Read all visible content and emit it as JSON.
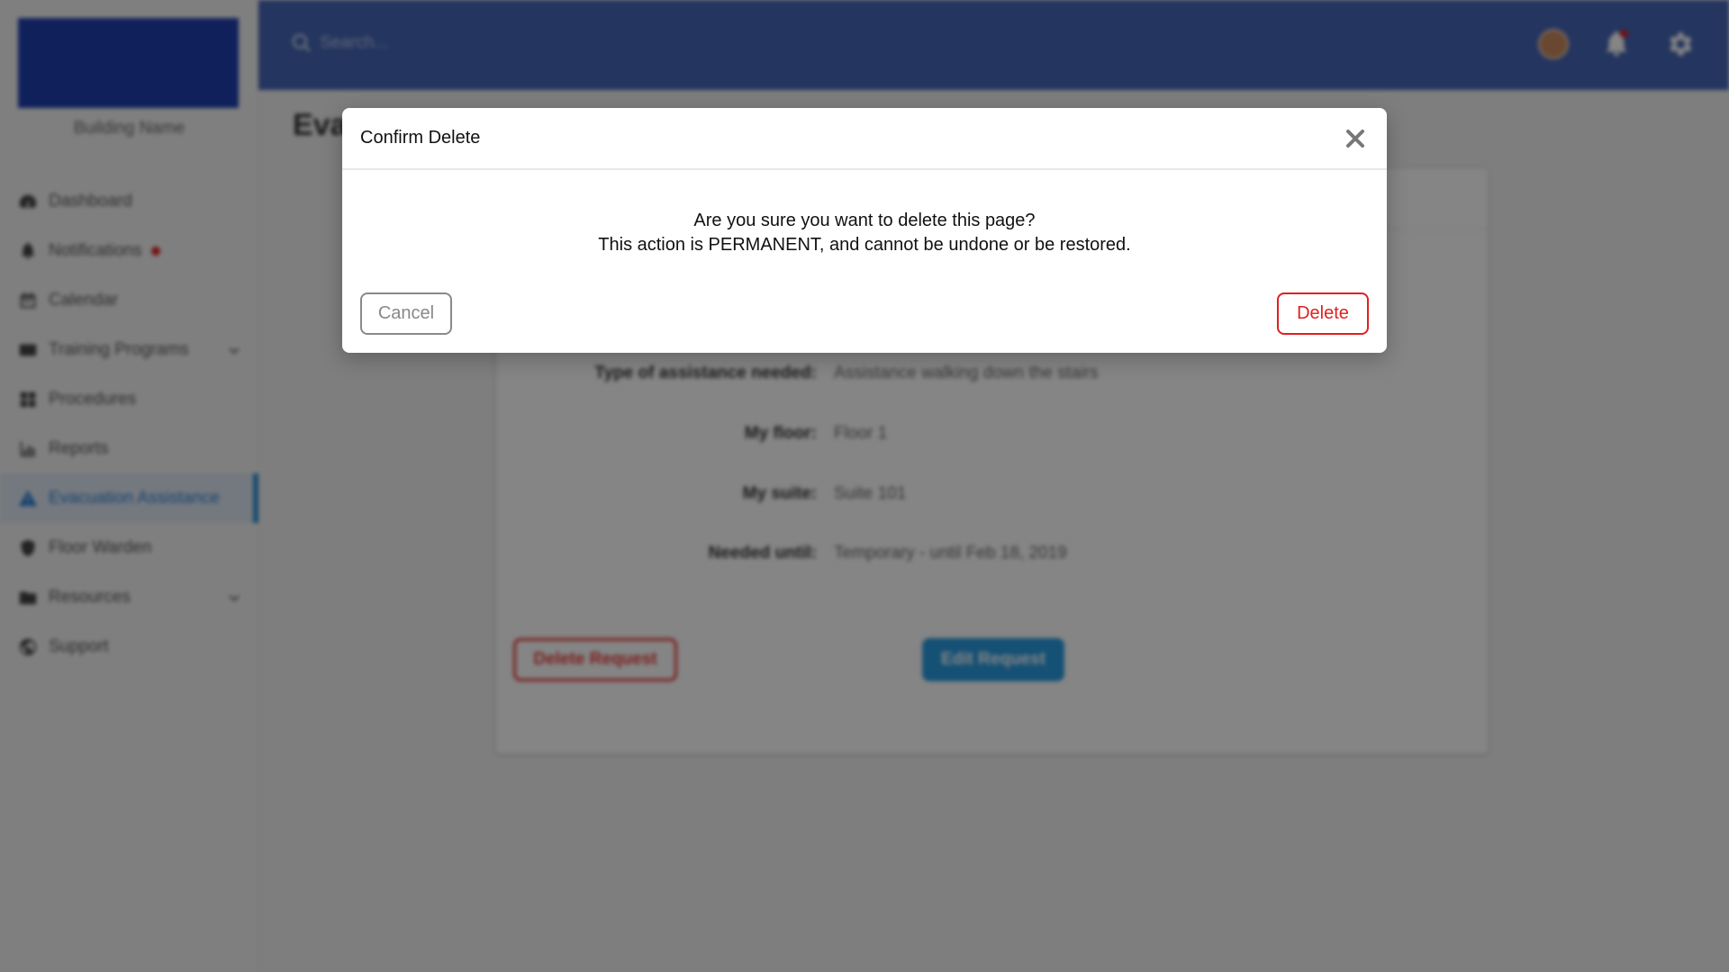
{
  "sidebar": {
    "building_name": "Building Name",
    "items": [
      {
        "label": "Dashboard",
        "icon": "dashboard-icon"
      },
      {
        "label": "Notifications",
        "icon": "bell-icon",
        "has_alert_dot": true
      },
      {
        "label": "Calendar",
        "icon": "calendar-icon"
      },
      {
        "label": "Training Programs",
        "icon": "training-icon",
        "has_chevron": true
      },
      {
        "label": "Procedures",
        "icon": "procedures-icon"
      },
      {
        "label": "Reports",
        "icon": "reports-icon"
      },
      {
        "label": "Evacuation Assistance",
        "icon": "warning-icon",
        "active": true
      },
      {
        "label": "Floor Warden",
        "icon": "shield-icon"
      },
      {
        "label": "Resources",
        "icon": "folder-icon",
        "has_chevron": true
      },
      {
        "label": "Support",
        "icon": "globe-icon"
      }
    ]
  },
  "topbar": {
    "search_placeholder": "Search...",
    "icons": [
      "avatar",
      "bell-icon",
      "gear-icon"
    ]
  },
  "page": {
    "title_visible": "Eva"
  },
  "card": {
    "details": [
      {
        "label": "Type of assistance needed:",
        "value": "Assistance walking down the stairs"
      },
      {
        "label": "My floor:",
        "value": "Floor 1"
      },
      {
        "label": "My suite:",
        "value": "Suite 101"
      },
      {
        "label": "Needed until:",
        "value": "Temporary - until Feb 18, 2019"
      }
    ],
    "delete_request_label": "Delete Request",
    "edit_request_label": "Edit Request"
  },
  "modal": {
    "title": "Confirm Delete",
    "message_line1": "Are you sure you want to delete this page?",
    "message_line2": "This action is PERMANENT, and cannot be undone or be restored.",
    "cancel_label": "Cancel",
    "delete_label": "Delete"
  },
  "colors": {
    "topbar": "#4566b6",
    "brand_logo": "#1f3fae",
    "active_nav": "#2a7fd6",
    "danger": "#e02020",
    "edit_button": "#2a9be0"
  }
}
